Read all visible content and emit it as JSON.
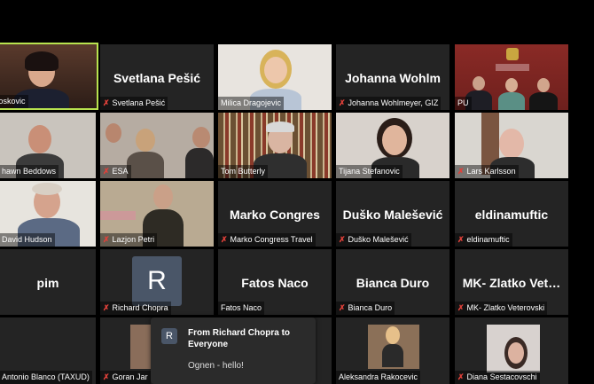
{
  "tiles": [
    {
      "id": "t1",
      "label": "a Boskovic",
      "big": "",
      "muted": false
    },
    {
      "id": "t2",
      "label": "Svetlana Pešić",
      "big": "Svetlana Pešić",
      "muted": true
    },
    {
      "id": "t3",
      "label": "Milica Dragojevic",
      "big": "",
      "muted": false
    },
    {
      "id": "t4",
      "label": "Johanna Wohlmeyer, GIZ",
      "big": "Johanna  Wohlm",
      "muted": true
    },
    {
      "id": "t5",
      "label": "PU",
      "big": "",
      "muted": false
    },
    {
      "id": "t6",
      "label": "hawn Beddows",
      "big": "",
      "muted": false
    },
    {
      "id": "t7",
      "label": "ESA",
      "big": "",
      "muted": true
    },
    {
      "id": "t8",
      "label": "Tom Butterly",
      "big": "",
      "muted": false
    },
    {
      "id": "t9",
      "label": "Tijana Stefanovic",
      "big": "",
      "muted": false
    },
    {
      "id": "t10",
      "label": "Lars Karlsson",
      "big": "",
      "muted": true
    },
    {
      "id": "t11",
      "label": "David Hudson",
      "big": "",
      "muted": false
    },
    {
      "id": "t12",
      "label": "Lazjon Petri",
      "big": "",
      "muted": true
    },
    {
      "id": "t13",
      "label": "Marko Congress Travel",
      "big": "Marko  Congres",
      "muted": true
    },
    {
      "id": "t14",
      "label": "Duško Malešević",
      "big": "Duško Malešević",
      "muted": true
    },
    {
      "id": "t15",
      "label": "eldinamuftic",
      "big": "eldinamuftic",
      "muted": true
    },
    {
      "id": "t16",
      "label": "",
      "big": "pim",
      "muted": false
    },
    {
      "id": "t17",
      "label": "Richard Chopra",
      "big": "",
      "muted": true,
      "avatar": "R"
    },
    {
      "id": "t18",
      "label": "Fatos Naco",
      "big": "Fatos Naco",
      "muted": false
    },
    {
      "id": "t19",
      "label": "Bianca Duro",
      "big": "Bianca Duro",
      "muted": true
    },
    {
      "id": "t20",
      "label": "MK- Zlatko Veterovski",
      "big": "MK-  Zlatko  Vet…",
      "muted": true
    },
    {
      "id": "t21",
      "label": "Antonio Blanco (TAXUD)",
      "big": "",
      "muted": false
    },
    {
      "id": "t22",
      "label": "Goran Jar",
      "big": "",
      "muted": true
    },
    {
      "id": "t23",
      "label": "",
      "big": "",
      "muted": false
    },
    {
      "id": "t24",
      "label": "Aleksandra Rakocevic",
      "big": "",
      "muted": false
    },
    {
      "id": "t25",
      "label": "Diana Sestacovschi",
      "big": "",
      "muted": true
    }
  ],
  "chat": {
    "avatar_letter": "R",
    "from": "From Richard Chopra to Everyone",
    "message": "Ognen - hello!"
  },
  "colors": {
    "tile_bg": "#242424",
    "active_border": "#b8e34f",
    "mute": "#e0413a"
  }
}
